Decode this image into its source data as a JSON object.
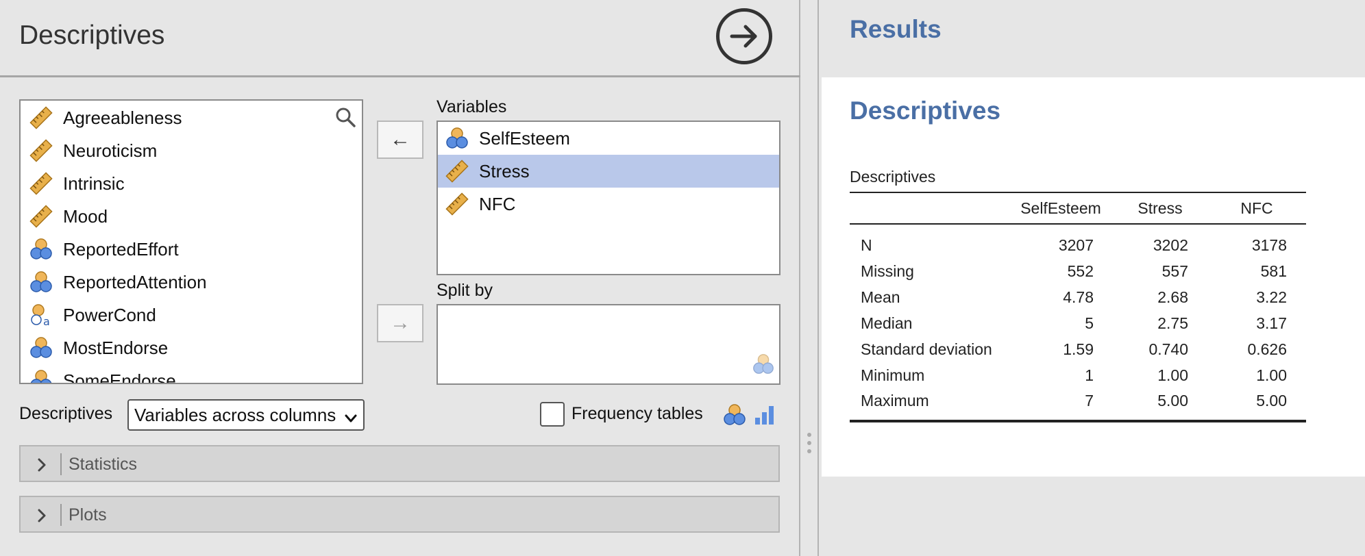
{
  "options_panel": {
    "title": "Descriptives",
    "run_button_icon": "arrow-right-circle-icon"
  },
  "source_variables": [
    {
      "label": "Agreeableness",
      "type": "continuous"
    },
    {
      "label": "Neuroticism",
      "type": "continuous"
    },
    {
      "label": "Intrinsic",
      "type": "continuous"
    },
    {
      "label": "Mood",
      "type": "continuous"
    },
    {
      "label": "ReportedEffort",
      "type": "nominal"
    },
    {
      "label": "ReportedAttention",
      "type": "nominal"
    },
    {
      "label": "PowerCond",
      "type": "nominal-text"
    },
    {
      "label": "MostEndorse",
      "type": "nominal"
    },
    {
      "label": "SomeEndorse",
      "type": "nominal"
    }
  ],
  "variables_box": {
    "label": "Variables",
    "items": [
      {
        "label": "SelfEsteem",
        "type": "nominal",
        "selected": false
      },
      {
        "label": "Stress",
        "type": "continuous",
        "selected": true
      },
      {
        "label": "NFC",
        "type": "continuous",
        "selected": false
      }
    ]
  },
  "split_by_box": {
    "label": "Split by"
  },
  "move_left_glyph": "←",
  "move_right_glyph": "→",
  "descriptives_option": {
    "label": "Descriptives",
    "selected": "Variables across columns"
  },
  "frequency_tables": {
    "label": "Frequency tables",
    "checked": false
  },
  "sections": [
    {
      "label": "Statistics",
      "expanded": false
    },
    {
      "label": "Plots",
      "expanded": false
    }
  ],
  "results": {
    "header": "Results",
    "title": "Descriptives",
    "table_caption": "Descriptives",
    "columns": [
      "",
      "SelfEsteem",
      "Stress",
      "NFC"
    ],
    "rows": [
      {
        "label": "N",
        "values": [
          "3207",
          "3202",
          "3178"
        ]
      },
      {
        "label": "Missing",
        "values": [
          "552",
          "557",
          "581"
        ]
      },
      {
        "label": "Mean",
        "values": [
          "4.78",
          "2.68",
          "3.22"
        ]
      },
      {
        "label": "Median",
        "values": [
          "5",
          "2.75",
          "3.17"
        ]
      },
      {
        "label": "Standard deviation",
        "values": [
          "1.59",
          "0.740",
          "0.626"
        ]
      },
      {
        "label": "Minimum",
        "values": [
          "1",
          "1.00",
          "1.00"
        ]
      },
      {
        "label": "Maximum",
        "values": [
          "7",
          "5.00",
          "5.00"
        ]
      }
    ]
  },
  "colors": {
    "accent": "#4a6fa5",
    "selection": "#b9c8ea",
    "ruler": "#e8b04a",
    "nominal_blue": "#5b8ee0",
    "nominal_orange": "#f0b65a"
  }
}
